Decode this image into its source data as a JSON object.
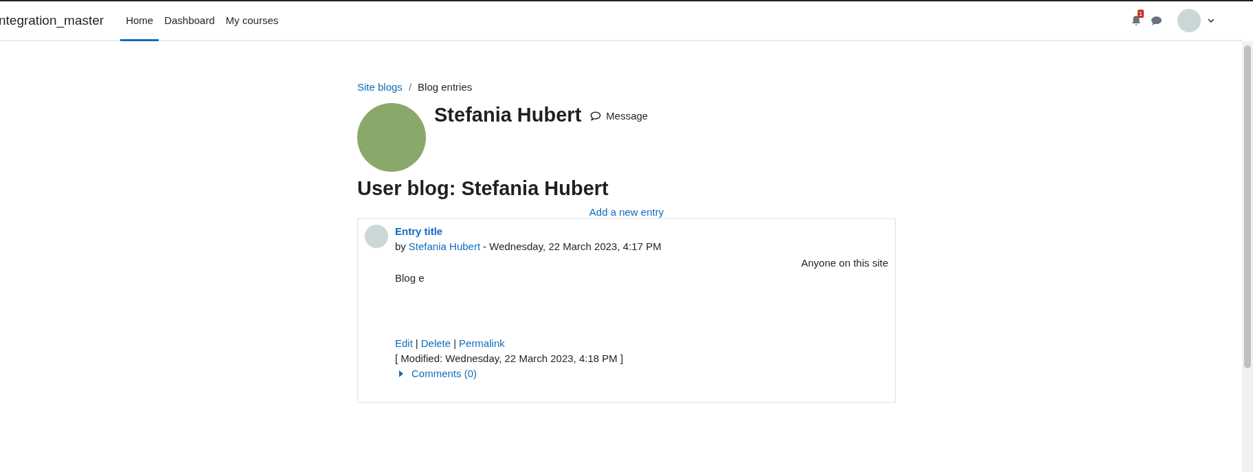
{
  "navbar": {
    "brand": "ntegration_master",
    "items": [
      {
        "label": "Home",
        "selected": true
      },
      {
        "label": "Dashboard",
        "selected": false
      },
      {
        "label": "My courses",
        "selected": false
      }
    ],
    "notification_count": "1"
  },
  "breadcrumb_separator": "/",
  "breadcrumb": [
    {
      "label": "Site blogs",
      "kind": "link"
    },
    {
      "label": "Blog entries",
      "kind": "current"
    }
  ],
  "profile": {
    "name": "Stefania Hubert",
    "message_label": "Message"
  },
  "heading": "User blog: Stefania Hubert",
  "add_entry": "Add a new entry",
  "entry": {
    "title": "Entry title",
    "by": "by",
    "author": "Stefania Hubert",
    "date": "- Wednesday, 22 March 2023, 4:17 PM",
    "visibility": "Anyone on this site",
    "body": "Blog e",
    "actions": [
      "Edit",
      "Delete",
      "Permalink"
    ],
    "separator": "|",
    "modified": "[ Modified: Wednesday, 22 March 2023, 4:18 PM ]",
    "comments": {
      "label": "Comments (0)",
      "expanded": false
    }
  }
}
